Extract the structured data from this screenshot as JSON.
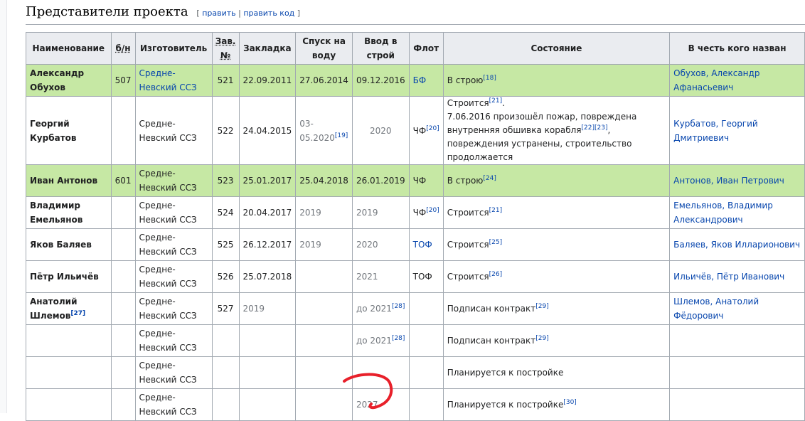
{
  "heading": {
    "title": "Представители проекта",
    "edit_open": "[",
    "edit_label": "править",
    "edit_sep": "|",
    "edit_code_label": "править код",
    "edit_close": "]"
  },
  "columns": [
    "Наименование",
    "б/н",
    "Изготовитель",
    "Зав. №",
    "Закладка",
    "Спуск на воду",
    "Ввод в строй",
    "Флот",
    "Состояние",
    "В честь кого назван"
  ],
  "rows": [
    {
      "name": "Александр Обухов",
      "bn": "507",
      "builder": "Средне-Невский ССЗ",
      "zav": "521",
      "laid": "22.09.2011",
      "launch": "27.06.2014",
      "commission": "09.12.2016",
      "fleet": "БФ",
      "status": "В строю",
      "status_ref": "[18]",
      "honor": "Обухов, Александр Афанасьевич"
    },
    {
      "name": "Георгий Курбатов",
      "bn": "",
      "builder": "Средне-Невский ССЗ",
      "zav": "522",
      "laid": "24.04.2015",
      "launch": "03-05.2020",
      "launch_ref": "[19]",
      "commission": "2020",
      "fleet": "ЧФ",
      "fleet_ref": "[20]",
      "status_line1": "Строится",
      "status_ref1": "[21]",
      "status_dot": ".",
      "status_line2": "7.06.2016 произошёл пожар, повреждена внутренняя обшивка корабля",
      "status_ref2a": "[22]",
      "status_ref2b": "[23]",
      "status_comma": ",",
      "status_line3": "повреждения устранены, строительство продолжается",
      "honor": "Курбатов, Георгий Дмитриевич"
    },
    {
      "name": "Иван Антонов",
      "bn": "601",
      "builder": "Средне-Невский ССЗ",
      "zav": "523",
      "laid": "25.01.2017",
      "launch": "25.04.2018",
      "commission": "26.01.2019",
      "fleet": "ЧФ",
      "status": "В строю",
      "status_ref": "[24]",
      "honor": "Антонов, Иван Петрович"
    },
    {
      "name": "Владимир Емельянов",
      "bn": "",
      "builder": "Средне-Невский ССЗ",
      "zav": "524",
      "laid": "20.04.2017",
      "launch": "2019",
      "commission": "2019",
      "fleet": "ЧФ",
      "fleet_ref": "[20]",
      "status": "Строится",
      "status_ref": "[21]",
      "honor": "Емельянов, Владимир Александрович"
    },
    {
      "name": "Яков Баляев",
      "bn": "",
      "builder": "Средне-Невский ССЗ",
      "zav": "525",
      "laid": "26.12.2017",
      "launch": "2019",
      "commission": "2020",
      "fleet": "ТОФ",
      "status": "Строится",
      "status_ref": "[25]",
      "honor": "Баляев, Яков Илларионович"
    },
    {
      "name": "Пётр Ильичёв",
      "bn": "",
      "builder": "Средне-Невский ССЗ",
      "zav": "526",
      "laid": "25.07.2018",
      "launch": "",
      "commission": "2021",
      "fleet": "ТОФ",
      "status": "Строится",
      "status_ref": "[26]",
      "honor": "Ильичёв, Пётр Иванович"
    },
    {
      "name": "Анатолий Шлемов",
      "name_ref": "[27]",
      "bn": "",
      "builder": "Средне-Невский ССЗ",
      "zav": "527",
      "laid": "2019",
      "launch": "",
      "commission": "до 2021",
      "commission_ref": "[28]",
      "fleet": "",
      "status": "Подписан контракт",
      "status_ref": "[29]",
      "honor": "Шлемов, Анатолий Фёдорович"
    },
    {
      "name": "",
      "bn": "",
      "builder": "Средне-Невский ССЗ",
      "zav": "",
      "laid": "",
      "launch": "",
      "commission": "до 2021",
      "commission_ref": "[28]",
      "fleet": "",
      "status": "Подписан контракт",
      "status_ref": "[29]",
      "honor": ""
    },
    {
      "name": "",
      "bn": "",
      "builder": "Средне-Невский ССЗ",
      "zav": "",
      "laid": "",
      "launch": "",
      "commission": "",
      "fleet": "",
      "status": "Планируется к постройке",
      "honor": ""
    },
    {
      "name": "",
      "bn": "",
      "builder": "Средне-Невский ССЗ",
      "zav": "",
      "laid": "",
      "launch": "",
      "commission": "2027",
      "fleet": "",
      "status": "Планируется к постройке",
      "status_ref": "[30]",
      "honor": ""
    }
  ],
  "colors": {
    "link": "#0645ad",
    "header_bg": "#eaecf0",
    "in_service_bg": "#c6e8a4",
    "border": "#a2a9b1",
    "annotation": "#e8202a"
  }
}
